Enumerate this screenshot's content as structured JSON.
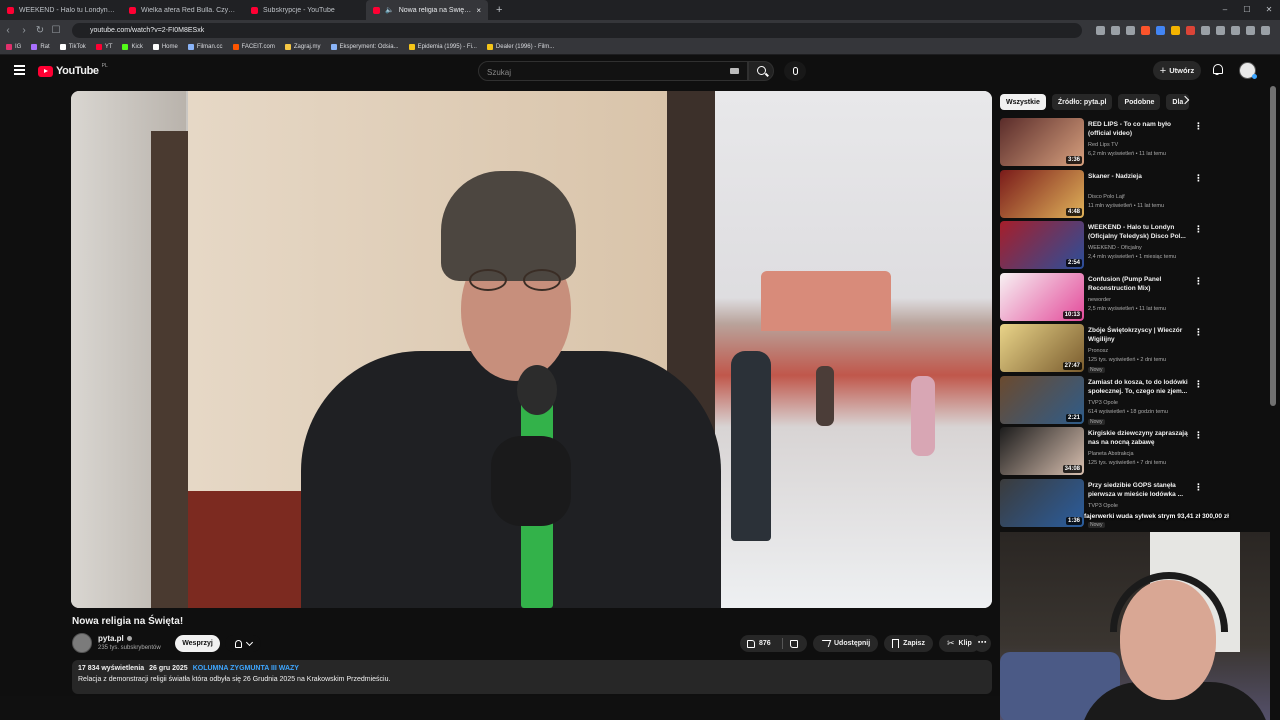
{
  "browser": {
    "tabs": [
      {
        "label": "WEEKEND - Halo tu Londyn (Oficjaln",
        "active": false,
        "audio": false
      },
      {
        "label": "Wielka afera Red Bulla. Czy ten napó",
        "active": false,
        "audio": false
      },
      {
        "label": "Subskrypcje - YouTube",
        "active": false,
        "audio": false
      },
      {
        "label": "Nowa religia na Święta! - You",
        "active": true,
        "audio": true
      }
    ],
    "new_tab": "+",
    "url": "youtube.com/watch?v=2-FI0M8ESxk",
    "bookmarks": [
      {
        "label": "IG",
        "color": "#e1306c"
      },
      {
        "label": "Rat",
        "color": "#a970ff"
      },
      {
        "label": "TikTok",
        "color": "#ffffff"
      },
      {
        "label": "YT",
        "color": "#ff0033"
      },
      {
        "label": "Kick",
        "color": "#53fc18"
      },
      {
        "label": "Home",
        "color": "#ffffff"
      },
      {
        "label": "Filman.cc",
        "color": "#8ab4f8"
      },
      {
        "label": "FACEIT.com",
        "color": "#ff5500"
      },
      {
        "label": "Zagraj.my",
        "color": "#f6c744"
      },
      {
        "label": "Eksperyment: Odsia...",
        "color": "#8ab4f8"
      },
      {
        "label": "Epidemia (1995) - Fi...",
        "color": "#f5c518"
      },
      {
        "label": "Dealer (1996) - Film...",
        "color": "#f5c518"
      }
    ]
  },
  "header": {
    "logo_text": "YouTube",
    "logo_country": "PL",
    "search_placeholder": "Szukaj",
    "create_label": "Utwórz",
    "create_plus": "+"
  },
  "video": {
    "title": "Nowa religia na Święta!",
    "channel": "pyta.pl",
    "subscribers": "235 tys. subskrybentów",
    "support_label": "Wesprzyj",
    "likes": "876",
    "share_label": "Udostępnij",
    "save_label": "Zapisz",
    "clip_label": "Klip",
    "more": "⋯",
    "clip_icon": "✂",
    "views": "17 834 wyświetlenia",
    "date": "26 gru 2025",
    "tag": "KOLUMNA ZYGMUNTA III WAZY",
    "description": "Relacja z demonstracji religii światła która odbyła się 26 Grudnia 2025 na Krakowskim Przedmieściu."
  },
  "sidebar": {
    "chips": [
      "Wszystkie",
      "Źródło: pyta.pl",
      "Podobne",
      "Dla"
    ],
    "recommendations": [
      {
        "title": "RED LIPS - To co nam było (official video)",
        "channel": "Red Lips TV",
        "meta": "6,2 mln wyświetleń • 11 lat temu",
        "duration": "3:36",
        "badge": "",
        "color1": "#5a2c2a",
        "color2": "#d7a07e"
      },
      {
        "title": "Skaner - Nadzieja",
        "channel": "Disco Polo Lajf",
        "meta": "11 mln wyświetleń • 11 lat temu",
        "duration": "4:48",
        "badge": "",
        "color1": "#7a1b1a",
        "color2": "#e0b35a"
      },
      {
        "title": "WEEKEND - Halo tu Londyn (Oficjalny Teledysk) Disco Pol...",
        "channel": "WEEKEND - Oficjalny",
        "meta": "2,4 mln wyświetleń • 1 miesiąc temu",
        "duration": "2:54",
        "badge": "",
        "color1": "#a61e2a",
        "color2": "#2a4f9b"
      },
      {
        "title": "Confusion (Pump Panel Reconstruction Mix)",
        "channel": "neworder",
        "meta": "2,5 mln wyświetleń • 11 lat temu",
        "duration": "10:13",
        "badge": "",
        "color1": "#f7f1f3",
        "color2": "#e34a9a"
      },
      {
        "title": "Zbóje Świętokrzyscy | Wieczór Wigilijny",
        "channel": "Pronosz",
        "meta": "125 tys. wyświetleń • 2 dni temu",
        "duration": "27:47",
        "badge": "Nowy",
        "color1": "#e9d489",
        "color2": "#7a5c2e"
      },
      {
        "title": "Zamiast do kosza, to do lodówki społecznej. To, czego nie zjem...",
        "channel": "TVP3 Opole",
        "meta": "614 wyświetleń • 18 godzin temu",
        "duration": "2:21",
        "badge": "Nowy",
        "color1": "#6b4a2e",
        "color2": "#2e5c8a"
      },
      {
        "title": "Kirgiskie dziewczyny zapraszają nas na nocną zabawę",
        "channel": "Planeta Abstrakcja",
        "meta": "125 tys. wyświetleń • 7 dni temu",
        "duration": "34:08",
        "badge": "",
        "color1": "#1c1c1c",
        "color2": "#d9c0b0"
      },
      {
        "title": "Przy siedzibie GOPS stanęła pierwsza w mieście lodówka ...",
        "channel": "TVP3 Opole",
        "meta": "",
        "duration": "1:36",
        "badge": "Nowy",
        "color1": "#3b3b3b",
        "color2": "#2a5d9e"
      }
    ]
  },
  "overlay": {
    "donation": "fajerwerki wuda sylwek strym   93,41 zł   300,00 zł"
  }
}
